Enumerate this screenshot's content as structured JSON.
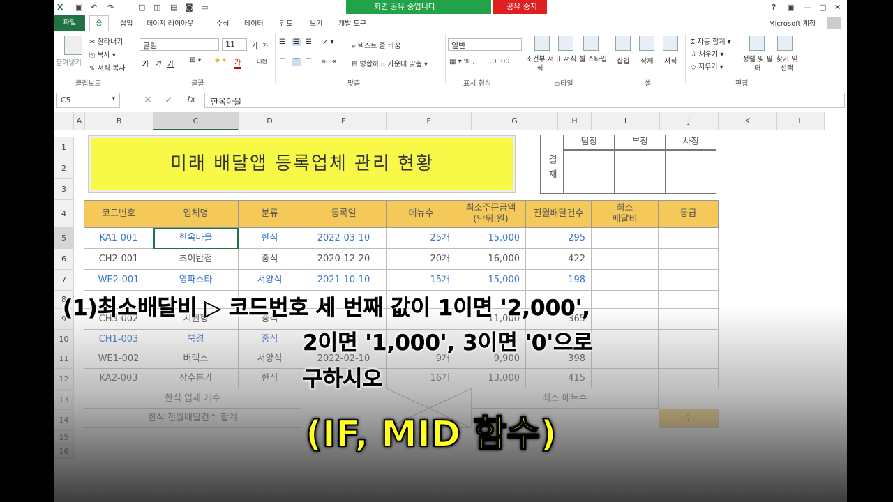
{
  "title_bar": {
    "share_text": "화면 공유 중입니다",
    "stop_text": "공유 중지",
    "account": "Microsoft 계정",
    "help": "?"
  },
  "tabs": [
    "파일",
    "홈",
    "삽입",
    "페이지 레이아웃",
    "수식",
    "데이터",
    "검토",
    "보기",
    "개발 도구"
  ],
  "ribbon": {
    "clipboard": {
      "paste": "붙여넣기",
      "cut": "잘라내기",
      "copy": "복사",
      "format_painter": "서식 복사",
      "group": "클립보드"
    },
    "font": {
      "name": "굴림",
      "size": "11",
      "group": "글꼴",
      "grow": "가",
      "shrink": "가",
      "bold": "가",
      "italic": "가",
      "underline": "가",
      "phonetic": "내천",
      "font_color": "가"
    },
    "align": {
      "wrap": "텍스트 줄 바꿈",
      "merge": "병합하고 가운데 맞춤",
      "group": "맞춤"
    },
    "number": {
      "format": "일반",
      "group": "표시 형식"
    },
    "styles": {
      "conditional": "조건부 서식",
      "table": "표 서식",
      "cell": "셀 스타일",
      "group": "스타일"
    },
    "cells": {
      "insert": "삽입",
      "delete": "삭제",
      "format": "서식",
      "group": "셀"
    },
    "editing": {
      "autosum": "자동 합계",
      "fill": "채우기",
      "clear": "지우기",
      "sort": "정렬 및 필터",
      "find": "찾기 및 선택",
      "group": "편집"
    }
  },
  "formula_bar": {
    "name_box": "C5",
    "formula": "한옥마을",
    "fx": "fx"
  },
  "columns": [
    "A",
    "B",
    "C",
    "D",
    "E",
    "F",
    "G",
    "H",
    "I",
    "J",
    "K",
    "L"
  ],
  "rows": [
    "1",
    "2",
    "3",
    "4",
    "5",
    "6",
    "7",
    "8",
    "9",
    "10",
    "11",
    "12",
    "13",
    "14",
    "15",
    "16"
  ],
  "banner_title": "미래 배달앱 등록업체 관리 현황",
  "approval": {
    "side": "결재",
    "roles": [
      "팀장",
      "부장",
      "사장"
    ]
  },
  "table_headers": [
    "코드번호",
    "업체명",
    "분류",
    "등록일",
    "메뉴수",
    "최소주문금액\n(단위:원)",
    "전월배달건수",
    "최소\n배달비",
    "등급"
  ],
  "table_rows": [
    {
      "code": "KA1-001",
      "name": "한옥마을",
      "cat": "한식",
      "date": "2022-03-10",
      "menu": "25개",
      "min": "15,000",
      "cnt": "295",
      "blue": true
    },
    {
      "code": "CH2-001",
      "name": "초이반점",
      "cat": "중식",
      "date": "2020-12-20",
      "menu": "20개",
      "min": "16,000",
      "cnt": "422",
      "blue": false
    },
    {
      "code": "WE2-001",
      "name": "영파스타",
      "cat": "서양식",
      "date": "2021-10-10",
      "menu": "15개",
      "min": "15,000",
      "cnt": "198",
      "blue": true
    },
    {
      "code": "",
      "name": "",
      "cat": "",
      "date": "",
      "menu": "",
      "min": "",
      "cnt": "",
      "blue": false
    },
    {
      "code": "CH3-002",
      "name": "시원향",
      "cat": "중식",
      "date": "",
      "menu": "",
      "min": "11,000",
      "cnt": "365",
      "blue": false
    },
    {
      "code": "CH1-003",
      "name": "북경",
      "cat": "중식",
      "date": "",
      "menu": "",
      "min": "",
      "cnt": "",
      "blue": true
    },
    {
      "code": "WE1-002",
      "name": "버텍스",
      "cat": "서양식",
      "date": "2022-02-10",
      "menu": "9개",
      "min": "9,900",
      "cnt": "398",
      "blue": false
    },
    {
      "code": "KA2-003",
      "name": "장수본가",
      "cat": "한식",
      "date": "",
      "menu": "16개",
      "min": "13,000",
      "cnt": "415",
      "blue": false
    }
  ],
  "summary": {
    "r13_label": "한식 업체 개수",
    "r13_right": "최소 메뉴수",
    "r14_label": "한식 전월배달건수 합계",
    "r14_right": "수"
  },
  "sheet_tabs": [
    "",
    "",
    "",
    ""
  ],
  "caption": {
    "line1": "(1)최소배달비 ▷ 코드번호 세 번째 값이 1이면 '2,000',",
    "line2": "2이면 '1,000', 3이면 '0'으로",
    "line3": "구하시오",
    "line4": "(IF, MID 함수)"
  }
}
